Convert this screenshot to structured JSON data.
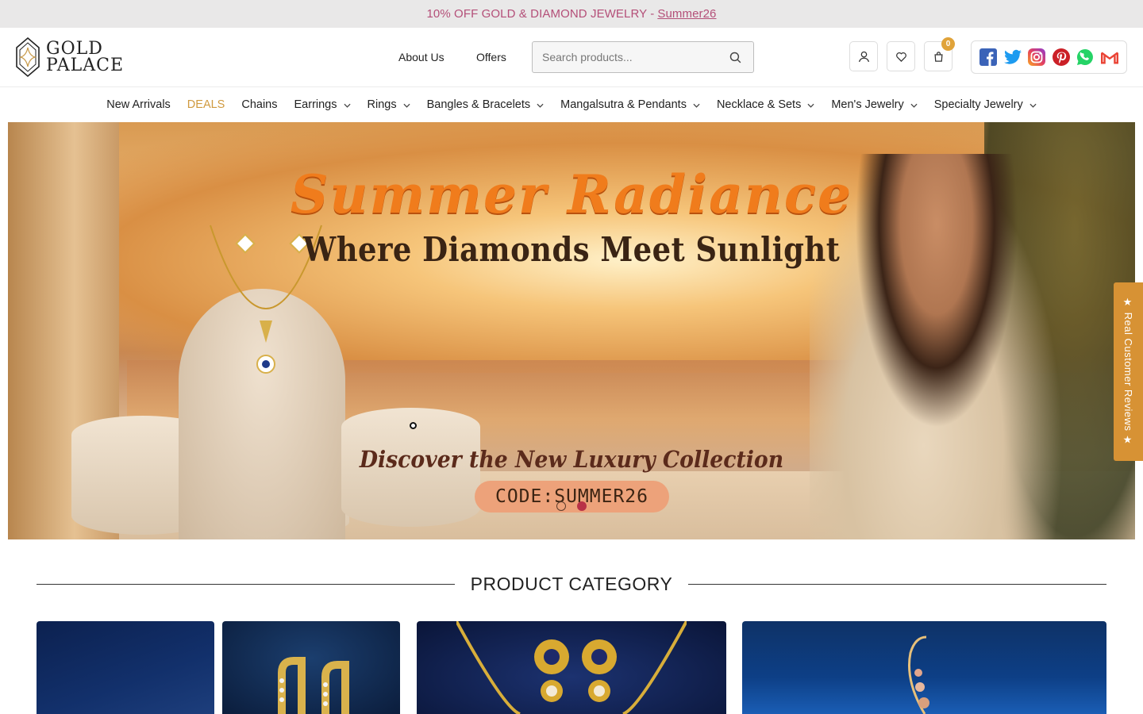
{
  "promo": {
    "text": "10% OFF GOLD & DIAMOND JEWELRY -",
    "code": "Summer26"
  },
  "header": {
    "logo_line1": "GOLD",
    "logo_line2": "PALACE",
    "links": [
      "About Us",
      "Offers"
    ],
    "search_placeholder": "Search products...",
    "cart_count": "0",
    "icons": [
      "user-icon",
      "heart-icon",
      "cart-icon"
    ],
    "social": [
      "facebook-icon",
      "twitter-icon",
      "instagram-icon",
      "pinterest-icon",
      "whatsapp-icon",
      "gmail-icon"
    ]
  },
  "nav": {
    "items": [
      {
        "label": "New Arrivals",
        "dropdown": false
      },
      {
        "label": "DEALS",
        "dropdown": false
      },
      {
        "label": "Chains",
        "dropdown": false
      },
      {
        "label": "Earrings",
        "dropdown": true
      },
      {
        "label": "Rings",
        "dropdown": true
      },
      {
        "label": "Bangles & Bracelets",
        "dropdown": true
      },
      {
        "label": "Mangalsutra & Pendants",
        "dropdown": true
      },
      {
        "label": "Necklace & Sets",
        "dropdown": true
      },
      {
        "label": "Men's Jewelry",
        "dropdown": true
      },
      {
        "label": "Specialty Jewelry",
        "dropdown": true
      }
    ]
  },
  "hero": {
    "title": "Summer Radiance",
    "subtitle": "Where Diamonds Meet Sunlight",
    "tagline": "Discover the New Luxury Collection",
    "code": "CODE:SUMMER26",
    "active_slide": 2,
    "slide_count": 2
  },
  "reviews_tab": "★ Real Customer Reviews ★",
  "section": {
    "title": "PRODUCT CATEGORY"
  },
  "colors": {
    "accent": "#d09a3f",
    "promo_text": "#b44f78",
    "badge": "#e0a33a",
    "review_tab": "#d79234"
  }
}
